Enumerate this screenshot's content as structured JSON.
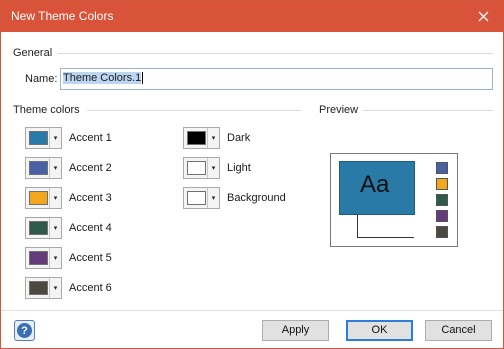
{
  "window": {
    "title": "New Theme Colors",
    "close_glyph": "✕"
  },
  "general": {
    "label": "General",
    "name_label": "Name:",
    "name_value": "Theme Colors.1"
  },
  "theme_colors": {
    "label": "Theme colors",
    "accents": [
      {
        "label": "Accent 1",
        "color": "#2a7aa8"
      },
      {
        "label": "Accent 2",
        "color": "#4862a3"
      },
      {
        "label": "Accent 3",
        "color": "#f3a71e"
      },
      {
        "label": "Accent 4",
        "color": "#2f5a4a"
      },
      {
        "label": "Accent 5",
        "color": "#643c7c"
      },
      {
        "label": "Accent 6",
        "color": "#4e4842"
      }
    ],
    "others": [
      {
        "label": "Dark",
        "color": "#000000"
      },
      {
        "label": "Light",
        "color": "#ffffff"
      },
      {
        "label": "Background",
        "color": "#ffffff"
      }
    ]
  },
  "preview": {
    "label": "Preview",
    "sample_text": "Aa"
  },
  "footer": {
    "help_glyph": "?",
    "apply": "Apply",
    "ok": "OK",
    "cancel": "Cancel"
  },
  "icons": {
    "dropdown": "▾"
  }
}
